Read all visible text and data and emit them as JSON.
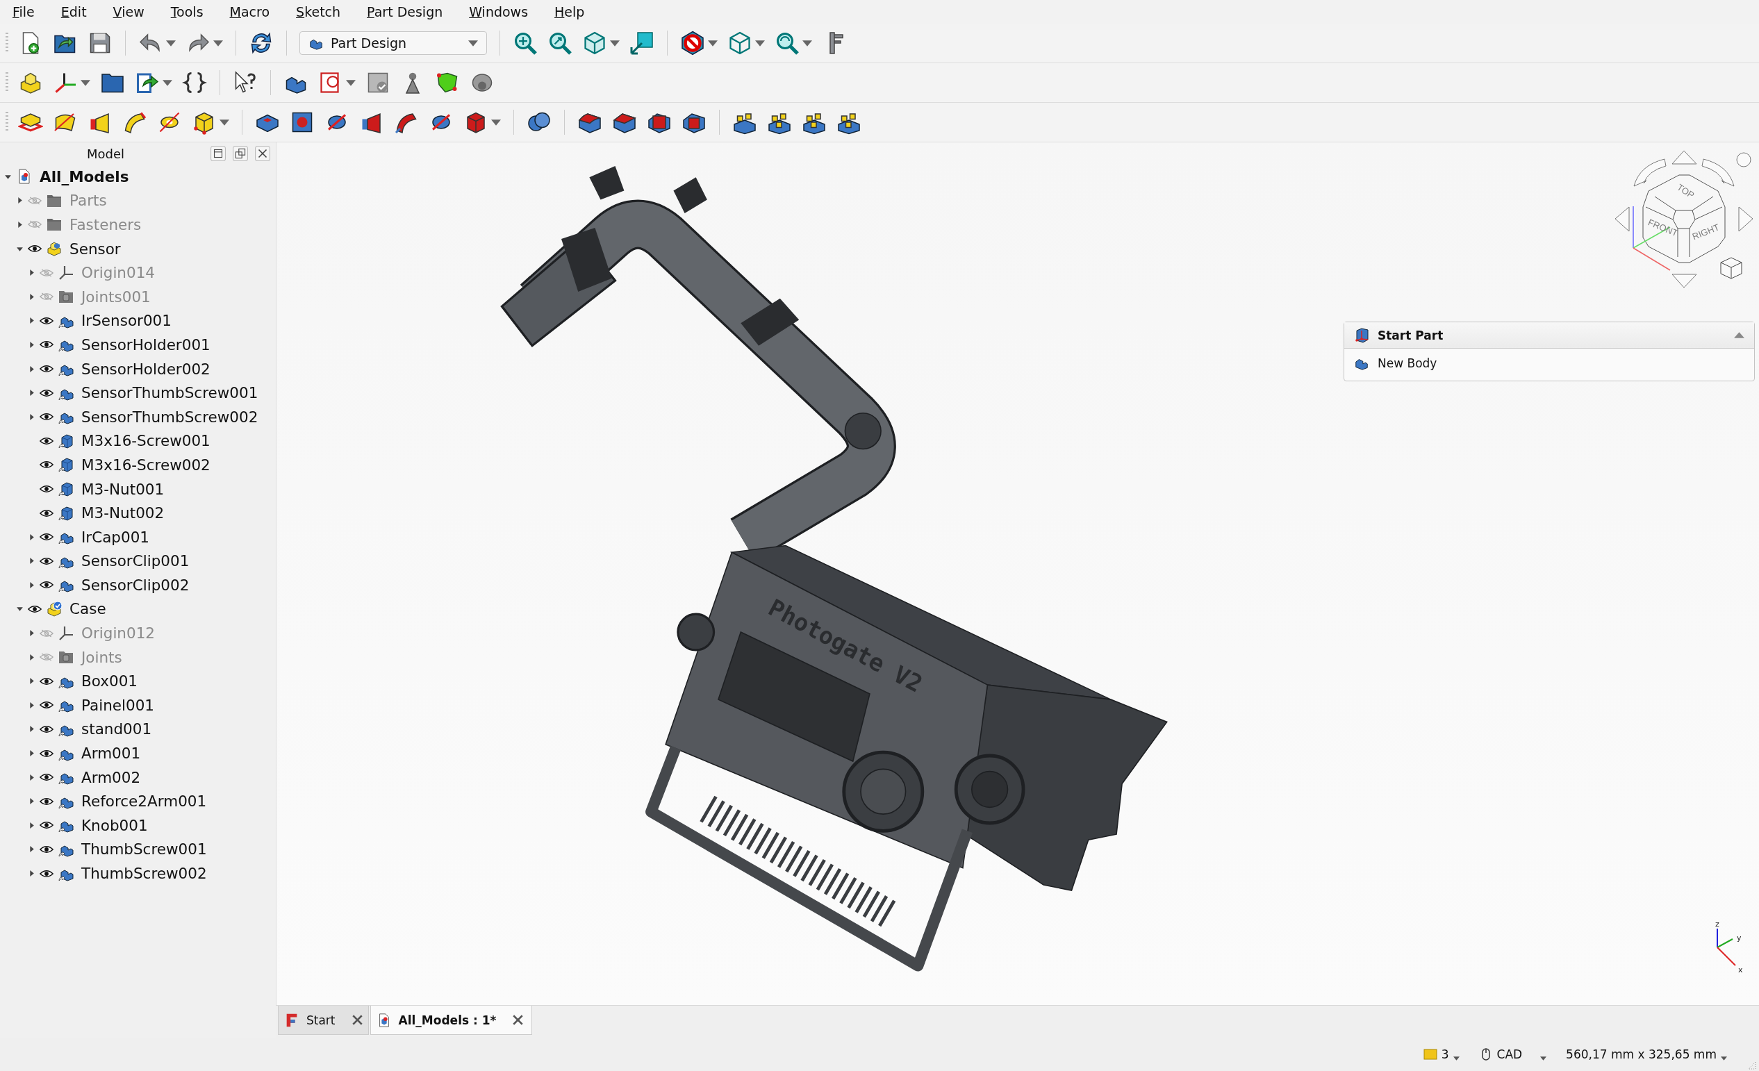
{
  "menu": [
    "File",
    "Edit",
    "View",
    "Tools",
    "Macro",
    "Sketch",
    "Part Design",
    "Windows",
    "Help"
  ],
  "workbench": "Part Design",
  "tree_panel": {
    "title": "Model"
  },
  "tree": {
    "label": "All_Models",
    "kind": "document",
    "expanded": true,
    "children": [
      {
        "label": "Parts",
        "kind": "folder",
        "visible": false,
        "expanded": false
      },
      {
        "label": "Fasteners",
        "kind": "folder",
        "visible": false,
        "expanded": false
      },
      {
        "label": "Sensor",
        "kind": "part",
        "visible": true,
        "expanded": true,
        "children": [
          {
            "label": "Origin014",
            "kind": "origin",
            "visible": false,
            "expanded": false
          },
          {
            "label": "Joints001",
            "kind": "joints",
            "visible": false,
            "expanded": false
          },
          {
            "label": "IrSensor001",
            "kind": "body",
            "visible": true,
            "expanded": false
          },
          {
            "label": "SensorHolder001",
            "kind": "body",
            "visible": true,
            "expanded": false
          },
          {
            "label": "SensorHolder002",
            "kind": "body",
            "visible": true,
            "expanded": false
          },
          {
            "label": "SensorThumbScrew001",
            "kind": "body",
            "visible": true,
            "expanded": false
          },
          {
            "label": "SensorThumbScrew002",
            "kind": "body",
            "visible": true,
            "expanded": false
          },
          {
            "label": "M3x16-Screw001",
            "kind": "solid",
            "visible": true
          },
          {
            "label": "M3x16-Screw002",
            "kind": "solid",
            "visible": true
          },
          {
            "label": "M3-Nut001",
            "kind": "solid",
            "visible": true
          },
          {
            "label": "M3-Nut002",
            "kind": "solid",
            "visible": true
          },
          {
            "label": "IrCap001",
            "kind": "body",
            "visible": true,
            "expanded": false
          },
          {
            "label": "SensorClip001",
            "kind": "body",
            "visible": true,
            "expanded": false
          },
          {
            "label": "SensorClip002",
            "kind": "body",
            "visible": true,
            "expanded": false
          }
        ]
      },
      {
        "label": "Case",
        "kind": "active-part",
        "visible": true,
        "expanded": true,
        "children": [
          {
            "label": "Origin012",
            "kind": "origin",
            "visible": false,
            "expanded": false
          },
          {
            "label": "Joints",
            "kind": "joints",
            "visible": false,
            "expanded": false
          },
          {
            "label": "Box001",
            "kind": "body",
            "visible": true,
            "expanded": false
          },
          {
            "label": "Painel001",
            "kind": "body",
            "visible": true,
            "expanded": false
          },
          {
            "label": "stand001",
            "kind": "body",
            "visible": true,
            "expanded": false
          },
          {
            "label": "Arm001",
            "kind": "body",
            "visible": true,
            "expanded": false
          },
          {
            "label": "Arm002",
            "kind": "body",
            "visible": true,
            "expanded": false
          },
          {
            "label": "Reforce2Arm001",
            "kind": "body",
            "visible": true,
            "expanded": false
          },
          {
            "label": "Knob001",
            "kind": "body",
            "visible": true,
            "expanded": false
          },
          {
            "label": "ThumbScrew001",
            "kind": "body",
            "visible": true,
            "expanded": false
          },
          {
            "label": "ThumbScrew002",
            "kind": "body",
            "visible": true,
            "expanded": false
          }
        ]
      }
    ]
  },
  "model_text": "Photogate V2",
  "navigation_cube": {
    "faces": [
      "TOP",
      "FRONT",
      "RIGHT"
    ]
  },
  "axis_labels": [
    "z",
    "y",
    "x"
  ],
  "task_panel": {
    "title": "Start Part",
    "expanded": true,
    "items": [
      "New Body"
    ]
  },
  "tabs": [
    {
      "label": "Start",
      "kind": "start",
      "selected": false
    },
    {
      "label": "All_Models : 1*",
      "kind": "document",
      "selected": true
    }
  ],
  "status_bar": {
    "layer": "3",
    "navigation": "CAD",
    "dimensions": "560,17 mm x 325,65 mm"
  }
}
